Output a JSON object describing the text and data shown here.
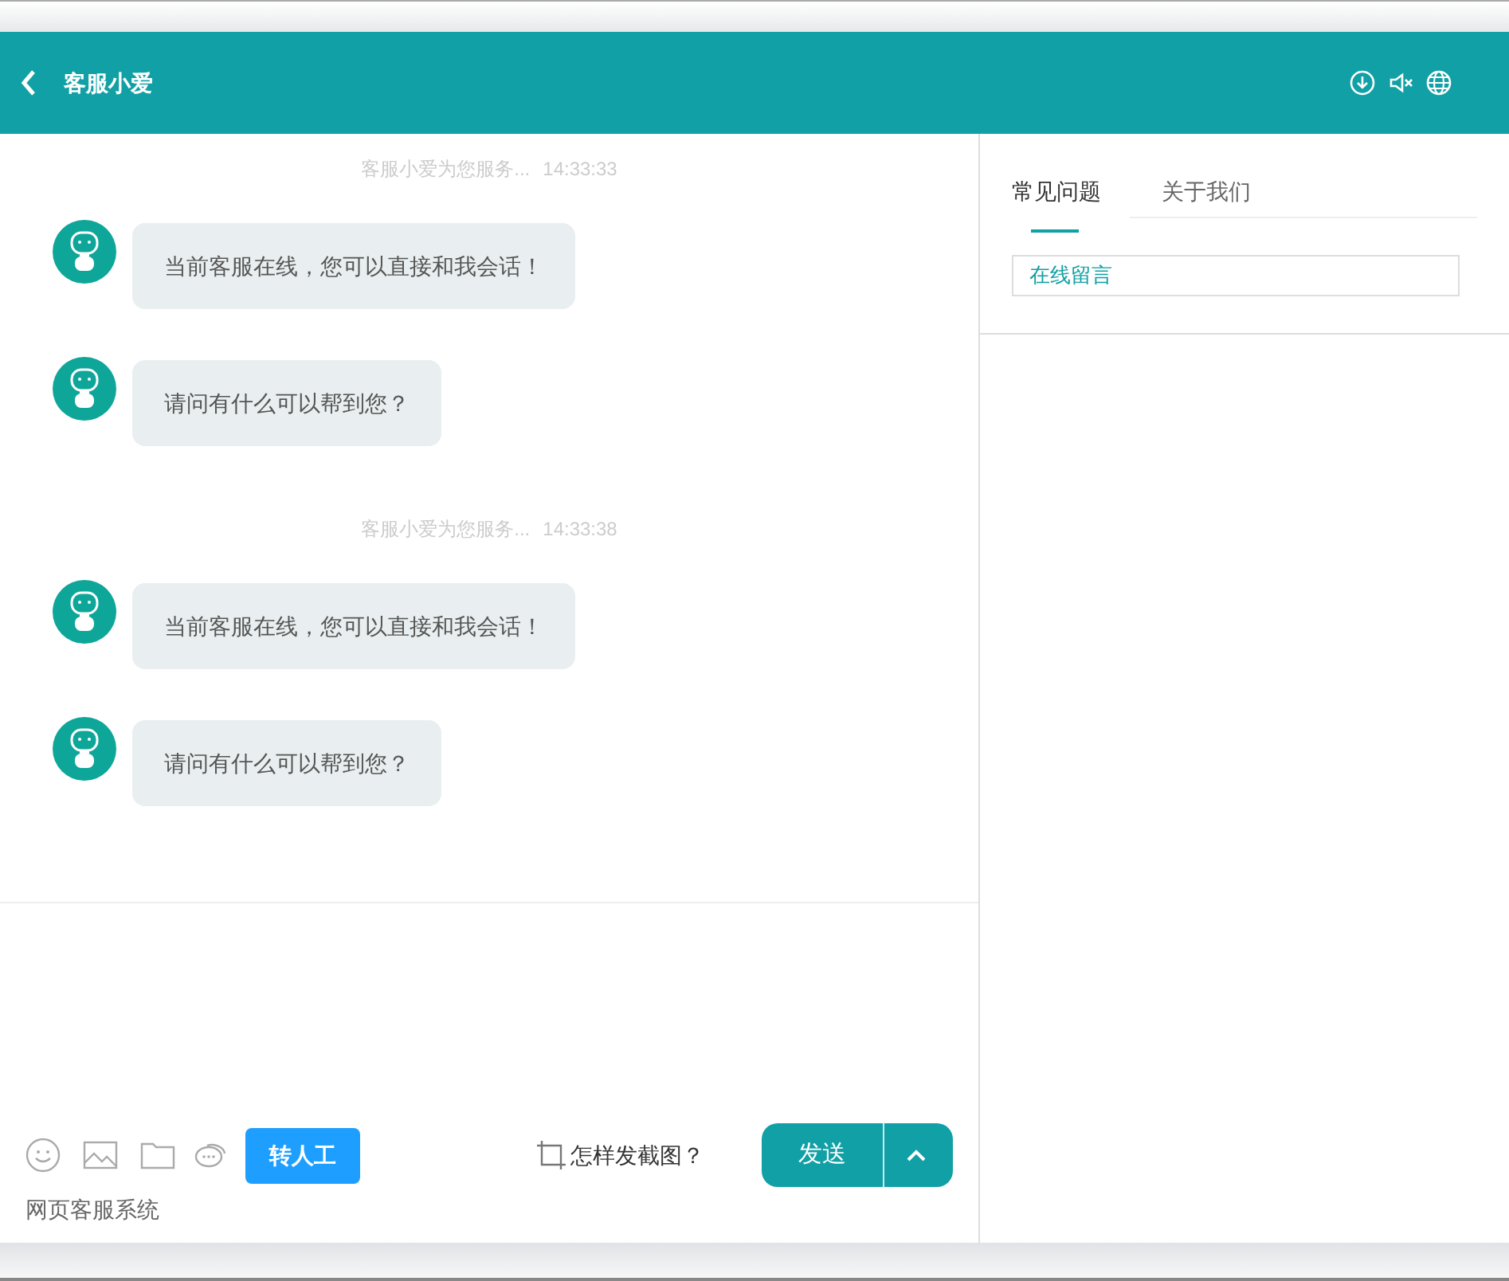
{
  "header": {
    "title": "客服小爱"
  },
  "messages": [
    {
      "kind": "time",
      "text": "客服小爱为您服务...",
      "time": "14:33:33"
    },
    {
      "kind": "message",
      "text": "当前客服在线，您可以直接和我会话！"
    },
    {
      "kind": "message",
      "text": "请问有什么可以帮到您？"
    },
    {
      "kind": "time",
      "text": "客服小爱为您服务...",
      "time": "14:33:38"
    },
    {
      "kind": "message",
      "text": "当前客服在线，您可以直接和我会话！"
    },
    {
      "kind": "message",
      "text": "请问有什么可以帮到您？"
    }
  ],
  "toolbar": {
    "transfer_button": "转人工",
    "screenshot_help": "怎样发截图？",
    "send_button": "发送",
    "footer": "网页客服系统"
  },
  "side_panel": {
    "tabs": [
      {
        "label": "常见问题",
        "selected": true
      },
      {
        "label": "关于我们",
        "selected": false
      }
    ],
    "links": [
      "在线留言"
    ]
  }
}
